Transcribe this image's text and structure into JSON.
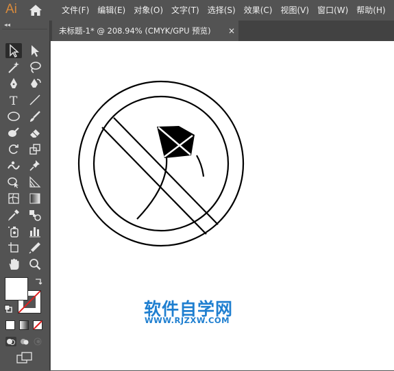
{
  "app": {
    "logo": "Ai"
  },
  "menu": [
    "文件(F)",
    "编辑(E)",
    "对象(O)",
    "文字(T)",
    "选择(S)",
    "效果(C)",
    "视图(V)",
    "窗口(W)",
    "帮助(H)"
  ],
  "document_tab": {
    "title": "未标题-1* @ 208.94% (CMYK/GPU 预览)",
    "close_glyph": "×"
  },
  "panel_collapse_glyph": "◂◂",
  "tools": [
    {
      "name": "selection-tool",
      "selected": true
    },
    {
      "name": "direct-selection-tool"
    },
    {
      "name": "magic-wand-tool"
    },
    {
      "name": "lasso-tool"
    },
    {
      "name": "pen-tool"
    },
    {
      "name": "curvature-tool"
    },
    {
      "name": "type-tool",
      "glyph": "T"
    },
    {
      "name": "line-segment-tool"
    },
    {
      "name": "ellipse-tool"
    },
    {
      "name": "paintbrush-tool"
    },
    {
      "name": "blob-brush-tool"
    },
    {
      "name": "eraser-tool"
    },
    {
      "name": "rotate-tool"
    },
    {
      "name": "scale-tool"
    },
    {
      "name": "puppet-warp-tool"
    },
    {
      "name": "pin-tool"
    },
    {
      "name": "shape-builder-tool"
    },
    {
      "name": "perspective-grid-tool"
    },
    {
      "name": "mesh-tool"
    },
    {
      "name": "gradient-tool"
    },
    {
      "name": "eyedropper-tool"
    },
    {
      "name": "blend-tool"
    },
    {
      "name": "symbol-sprayer-tool"
    },
    {
      "name": "column-graph-tool"
    },
    {
      "name": "artboard-tool"
    },
    {
      "name": "slice-tool"
    },
    {
      "name": "hand-tool"
    },
    {
      "name": "zoom-tool"
    }
  ],
  "colors": {
    "fill": "#ffffff",
    "stroke": "none-indicator",
    "accent_logo": "#d98b3c",
    "watermark": "#1f7fd0"
  },
  "watermark": {
    "name": "软件自学网",
    "url": "WWW.RJZXW.COM"
  }
}
